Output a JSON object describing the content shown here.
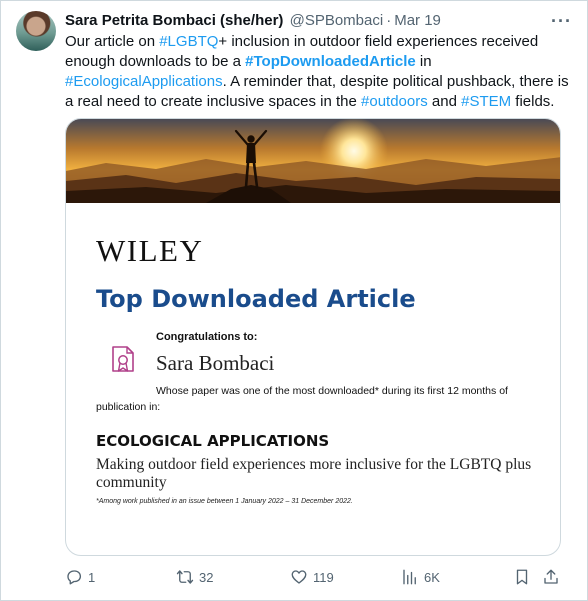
{
  "tweet": {
    "author_name": "Sara Petrita Bombaci (she/her)",
    "handle": "@SPBombaci",
    "separator": "·",
    "date": "Mar 19",
    "more_label": "···",
    "text": {
      "p1": "Our article on ",
      "tag1": "#LGBTQ",
      "p2": "+ inclusion in outdoor field experiences received enough downloads to be a ",
      "tag2": "#TopDownloadedArticle",
      "p3": " in ",
      "tag3": "#EcologicalApplications",
      "p4": ". A reminder that, despite political pushback, there is a real need to create inclusive spaces in the ",
      "tag4": "#outdoors",
      "p5": " and ",
      "tag5": "#STEM",
      "p6": " fields."
    },
    "link_color": "#1d9bf0"
  },
  "card": {
    "publisher": "WILEY",
    "award_title": "Top Downloaded Article",
    "congrats": "Congratulations to:",
    "winner": "Sara Bombaci",
    "whose_line1": "Whose paper was one of the most downloaded* during its first 12 months of",
    "whose_line2": "publication in:",
    "journal": "ECOLOGICAL APPLICATIONS",
    "paper_title": "Making outdoor field experiences more inclusive for the LGBTQ plus community",
    "footnote": "*Among work published in an issue between 1 January 2022 – 31 December 2022.",
    "accent_color": "#1a4c8c",
    "icon": "certificate-icon"
  },
  "actions": {
    "reply": {
      "icon": "reply-icon",
      "count": "1"
    },
    "retweet": {
      "icon": "retweet-icon",
      "count": "32"
    },
    "like": {
      "icon": "heart-icon",
      "count": "119"
    },
    "views": {
      "icon": "views-icon",
      "count": "6K"
    },
    "bookmark": {
      "icon": "bookmark-icon"
    },
    "share": {
      "icon": "share-icon"
    }
  }
}
